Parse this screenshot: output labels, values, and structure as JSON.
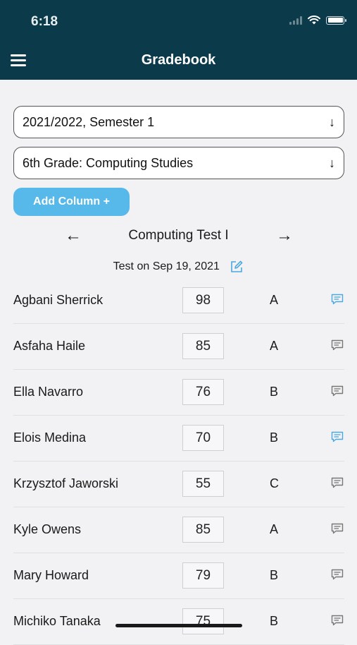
{
  "status": {
    "time": "6:18"
  },
  "header": {
    "title": "Gradebook"
  },
  "filters": {
    "term": "2021/2022, Semester 1",
    "class": "6th Grade: Computing Studies"
  },
  "add_column_label": "Add Column +",
  "column": {
    "title": "Computing Test I",
    "date_label": "Test on Sep 19, 2021"
  },
  "students": [
    {
      "name": "Agbani Sherrick",
      "score": "98",
      "grade": "A",
      "comment_active": true
    },
    {
      "name": "Asfaha Haile",
      "score": "85",
      "grade": "A",
      "comment_active": false
    },
    {
      "name": "Ella Navarro",
      "score": "76",
      "grade": "B",
      "comment_active": false
    },
    {
      "name": "Elois Medina",
      "score": "70",
      "grade": "B",
      "comment_active": true
    },
    {
      "name": "Krzysztof Jaworski",
      "score": "55",
      "grade": "C",
      "comment_active": false
    },
    {
      "name": "Kyle Owens",
      "score": "85",
      "grade": "A",
      "comment_active": false
    },
    {
      "name": "Mary Howard",
      "score": "79",
      "grade": "B",
      "comment_active": false
    },
    {
      "name": "Michiko Tanaka",
      "score": "75",
      "grade": "B",
      "comment_active": false
    }
  ],
  "colors": {
    "header_bg": "#0b3a4a",
    "accent": "#56b9ea",
    "comment_active": "#4aa8e0",
    "comment_inactive": "#777777"
  }
}
